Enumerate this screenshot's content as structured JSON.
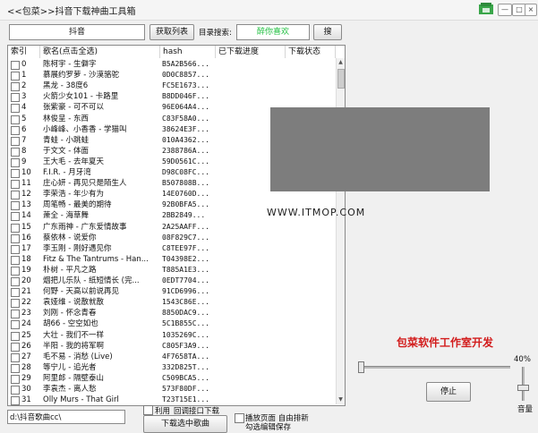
{
  "window": {
    "title": "<<包菜>>抖音下载神曲工具箱",
    "minimize": "—",
    "restore": "□",
    "close": "×"
  },
  "toolbar": {
    "source_value": "抖音",
    "fetch_label": "获取列表",
    "search_label": "目录搜索:",
    "search_value": "醉你喜欢",
    "search_button": "搜"
  },
  "table": {
    "headers": [
      "索引",
      "歌名(点击全选)",
      "hash",
      "已下载进度",
      "下载状态"
    ],
    "rows": [
      {
        "index": "0",
        "song": "陈柯宇 - 生僻字",
        "hash": "B5A2B566..."
      },
      {
        "index": "1",
        "song": "慕展约罗萝 - 沙漠骆驼",
        "hash": "0D0C8857..."
      },
      {
        "index": "2",
        "song": "黑龙 - 38度6",
        "hash": "FC5E1673..."
      },
      {
        "index": "3",
        "song": "火箭少女101 - 卡路里",
        "hash": "B8DD046F..."
      },
      {
        "index": "4",
        "song": "张紫豪 - 可不可以",
        "hash": "96E064A4..."
      },
      {
        "index": "5",
        "song": "林俊呈 - 东西",
        "hash": "C83F58A0..."
      },
      {
        "index": "6",
        "song": "小峰峰、小香香 - 学猫叫",
        "hash": "38624E3F..."
      },
      {
        "index": "7",
        "song": "青蛙 - 小跳蛙",
        "hash": "010A4362..."
      },
      {
        "index": "8",
        "song": "于文文 - 体面",
        "hash": "2388786A..."
      },
      {
        "index": "9",
        "song": "王大毛 - 去年夏天",
        "hash": "59D0561C..."
      },
      {
        "index": "10",
        "song": "F.I.R. - 月牙湾",
        "hash": "D98C08FC..."
      },
      {
        "index": "11",
        "song": "庄心妍 - 再见只是陌生人",
        "hash": "B507808B..."
      },
      {
        "index": "12",
        "song": "李荣浩 - 年少有为",
        "hash": "14E0760D..."
      },
      {
        "index": "13",
        "song": "周笔畅 - 最美的期待",
        "hash": "92B0BFA5..."
      },
      {
        "index": "14",
        "song": "萧全 - 海草舞",
        "hash": "2BB2849..."
      },
      {
        "index": "15",
        "song": "广东雨神 - 广东爱情故事",
        "hash": "2A25AAFF..."
      },
      {
        "index": "16",
        "song": "蔡依林 - 说爱你",
        "hash": "08F829C7..."
      },
      {
        "index": "17",
        "song": "李玉刚 - 刚好遇见你",
        "hash": "C8TEE97F..."
      },
      {
        "index": "18",
        "song": "Fitz & The Tantrums - Han...",
        "hash": "T04398E2..."
      },
      {
        "index": "19",
        "song": "朴树 - 平凡之路",
        "hash": "T885A1E3..."
      },
      {
        "index": "20",
        "song": "烟把儿乐队 - 纸短情长 (完...",
        "hash": "0EDT7704..."
      },
      {
        "index": "21",
        "song": "何野 - 天高以前说再见",
        "hash": "91CD6996..."
      },
      {
        "index": "22",
        "song": "袁娅维 - 说散就散",
        "hash": "1543C86E..."
      },
      {
        "index": "23",
        "song": "刘刚 - 怀念青春",
        "hash": "8850DAC9..."
      },
      {
        "index": "24",
        "song": "胡66 - 空空如也",
        "hash": "5C1B855C..."
      },
      {
        "index": "25",
        "song": "大壮 - 我们不一样",
        "hash": "1035269C..."
      },
      {
        "index": "26",
        "song": "半阳 - 我的将军啊",
        "hash": "C805F3A9..."
      },
      {
        "index": "27",
        "song": "毛不易 - 消愁 (Live)",
        "hash": "4F7658TA..."
      },
      {
        "index": "28",
        "song": "等宁儿 - 追光者",
        "hash": "332D825T..."
      },
      {
        "index": "29",
        "song": "阿里郎 - 隔壁泰山",
        "hash": "C509BCA5..."
      },
      {
        "index": "30",
        "song": "李袁杰 - 离人愁",
        "hash": "573F80DF..."
      },
      {
        "index": "31",
        "song": "Olly Murs - That Girl",
        "hash": "T23T15E1..."
      }
    ]
  },
  "overlay": {
    "watermark": "WWW.ITMOP.COM"
  },
  "studio_text": "包菜软件工作室开发",
  "player": {
    "progress": 0.0,
    "volume_text": "40%",
    "volume_level": 0.4,
    "stop_label": "停止",
    "volume_label": "音量"
  },
  "bottom": {
    "path_value": "d:\\抖音歌曲cc\\",
    "use_label": "利用",
    "backup_label": "回调接口下载",
    "download_label": "下载选中歌曲",
    "play_toggle_label": "播放页面 自由排新",
    "save_label": "勾选编辑保存"
  }
}
